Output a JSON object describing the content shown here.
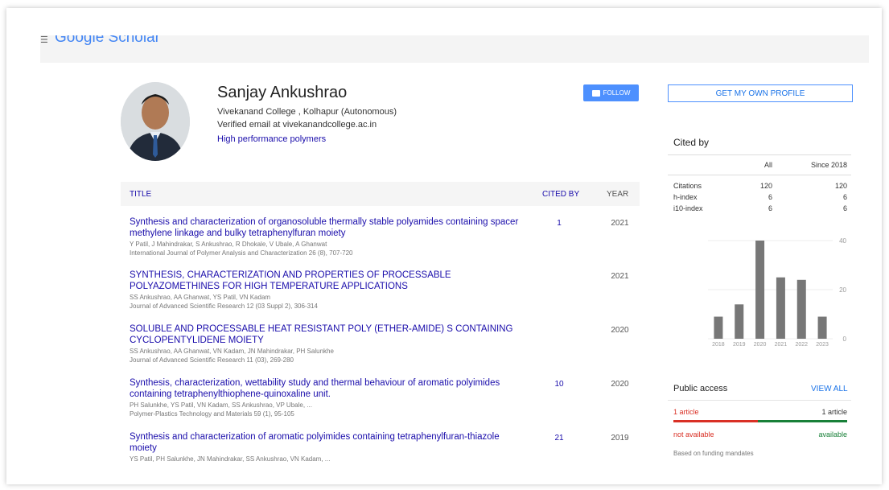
{
  "header": {
    "logo_text": "Google Scholar"
  },
  "profile": {
    "name": "Sanjay Ankushrao",
    "affiliation": "Vivekanand College , Kolhapur (Autonomous)",
    "email": "Verified email at vivekanandcollege.ac.in",
    "interest": "High performance polymers",
    "follow_label": "FOLLOW",
    "own_profile_label": "GET MY OWN PROFILE"
  },
  "table": {
    "headers": {
      "title": "TITLE",
      "cited_by": "CITED BY",
      "year": "YEAR"
    },
    "rows": [
      {
        "title": "Synthesis and characterization of organosoluble thermally stable polyamides containing spacer methylene linkage and bulky tetraphenylfuran moiety",
        "authors": "Y Patil, J Mahindrakar, S Ankushrao, R Dhokale, V Ubale, A Ghanwat",
        "venue": "International Journal of Polymer Analysis and Characterization 26 (8), 707-720",
        "cited_by": "1",
        "year": "2021"
      },
      {
        "title": "SYNTHESIS, CHARACTERIZATION AND PROPERTIES OF PROCESSABLE POLYAZOMETHINES FOR HIGH TEMPERATURE APPLICATIONS",
        "authors": "SS Ankushrao, AA Ghanwat, YS Patil, VN Kadam",
        "venue": "Journal of Advanced Scientific Research 12 (03 Suppl 2), 306-314",
        "cited_by": "",
        "year": "2021"
      },
      {
        "title": "SOLUBLE AND PROCESSABLE HEAT RESISTANT POLY (ETHER-AMIDE) S CONTAINING CYCLOPENTYLIDENE MOIETY",
        "authors": "SS Ankushrao, AA Ghanwat, VN Kadam, JN Mahindrakar, PH Salunkhe",
        "venue": "Journal of Advanced Scientific Research 11 (03), 269-280",
        "cited_by": "",
        "year": "2020"
      },
      {
        "title": "Synthesis, characterization, wettability study and thermal behaviour of aromatic polyimides containing tetraphenylthiophene-quinoxaline unit.",
        "authors": "PH Salunkhe, YS Patil, VN Kadam, SS Ankushrao, VP Ubale, ...",
        "venue": "Polymer-Plastics Technology and Materials 59 (1), 95-105",
        "cited_by": "10",
        "year": "2020"
      },
      {
        "title": "Synthesis and characterization of aromatic polyimides containing tetraphenylfuran-thiazole moiety",
        "authors": "YS Patil, PH Salunkhe, JN Mahindrakar, SS Ankushrao, VN Kadam, ...",
        "venue": "",
        "cited_by": "21",
        "year": "2019"
      }
    ]
  },
  "cited_by": {
    "header": "Cited by",
    "col_all": "All",
    "col_since": "Since 2018",
    "rows": [
      {
        "label": "Citations",
        "all": "120",
        "since": "120"
      },
      {
        "label": "h-index",
        "all": "6",
        "since": "6"
      },
      {
        "label": "i10-index",
        "all": "6",
        "since": "6"
      }
    ]
  },
  "chart_data": {
    "type": "bar",
    "categories": [
      "2018",
      "2019",
      "2020",
      "2021",
      "2022",
      "2023"
    ],
    "values": [
      9,
      14,
      40,
      25,
      24,
      9
    ],
    "ylim": [
      0,
      40
    ],
    "yticks": [
      "40",
      "20",
      "0"
    ],
    "colors": {
      "bar": "#777777"
    }
  },
  "public_access": {
    "header": "Public access",
    "view_all": "VIEW ALL",
    "left1": "1 article",
    "right1": "1 article",
    "left2": "not available",
    "right2": "available",
    "note": "Based on funding mandates"
  }
}
